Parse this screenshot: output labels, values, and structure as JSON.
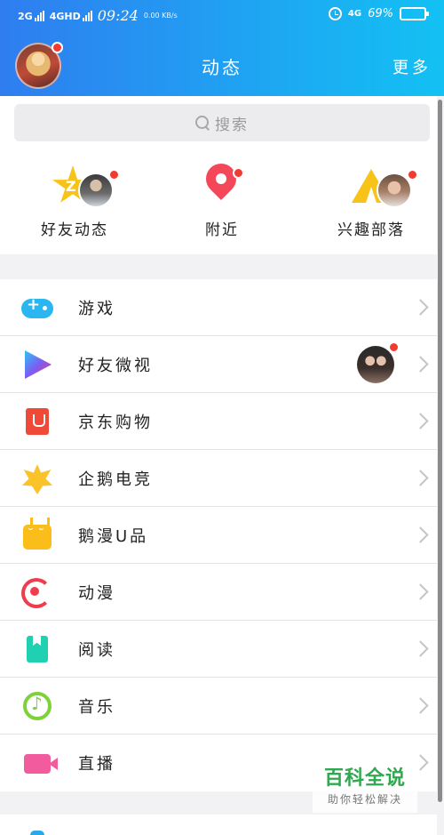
{
  "status_bar": {
    "network_1": "2G",
    "network_2": "4GHD",
    "time": "09:24",
    "speed": "0.00 KB/s",
    "network_right": "4G",
    "battery_text": "69%",
    "battery_level": 0.69
  },
  "header": {
    "title": "动态",
    "more_label": "更多"
  },
  "search": {
    "placeholder": "搜索"
  },
  "quick_entries": [
    {
      "label": "好友动态",
      "icon": "friends-star-icon"
    },
    {
      "label": "附近",
      "icon": "location-pin-icon"
    },
    {
      "label": "兴趣部落",
      "icon": "tent-icon"
    }
  ],
  "list": [
    {
      "label": "游戏",
      "icon": "gamepad-icon",
      "color": "#2ab6f0"
    },
    {
      "label": "好友微视",
      "icon": "play-triangle-icon",
      "color": "#7a5ef4"
    },
    {
      "label": "京东购物",
      "icon": "shopping-bag-icon",
      "color": "#ef4a38"
    },
    {
      "label": "企鹅电竞",
      "icon": "crown-badge-icon",
      "color": "#fbc32a"
    },
    {
      "label": "鹅漫U品",
      "icon": "tv-character-icon",
      "color": "#fbbd1a"
    },
    {
      "label": "动漫",
      "icon": "anime-icon",
      "color": "#ef3d4d"
    },
    {
      "label": "阅读",
      "icon": "bookmark-icon",
      "color": "#1fd0b1"
    },
    {
      "label": "音乐",
      "icon": "music-note-icon",
      "color": "#7dd23a"
    },
    {
      "label": "直播",
      "icon": "video-camera-icon",
      "color": "#f25c9e"
    }
  ],
  "watermark": {
    "main": "百科全说",
    "sub": "助你轻松解决"
  },
  "colors": {
    "header_start": "#2f7df0",
    "header_end": "#13c1f3",
    "badge_red": "#f23b30"
  }
}
